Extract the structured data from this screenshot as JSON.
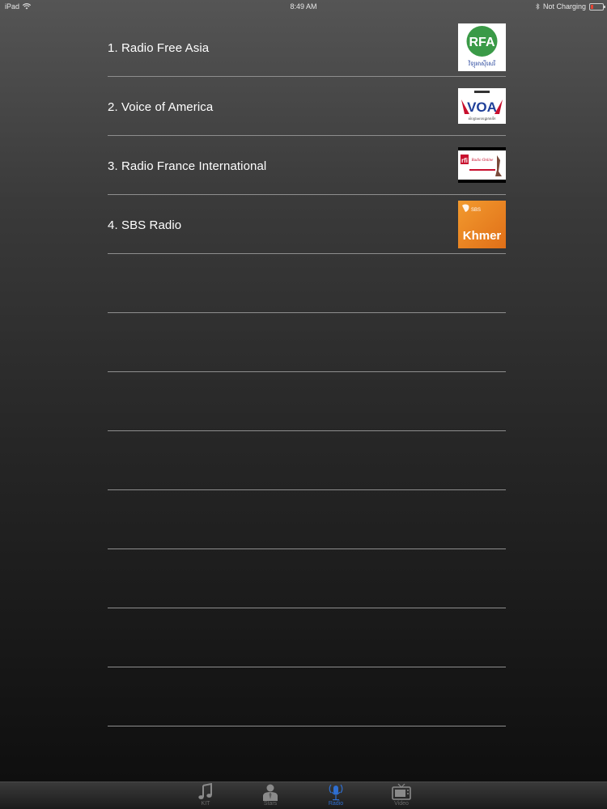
{
  "status_bar": {
    "device": "iPad",
    "time": "8:49 AM",
    "charging": "Not Charging"
  },
  "stations": [
    {
      "label": "1. Radio Free Asia",
      "logo_text": "RFA",
      "logo_subtext": "វិទ្យុអាស៊ីសេរី"
    },
    {
      "label": "2. Voice of America",
      "logo_text": "VOA",
      "logo_subtext": "សំឡេងសហរដ្ឋអាមេរិក"
    },
    {
      "label": "3. Radio France International",
      "logo_text": "rfi",
      "logo_subtext": "Radio Online"
    },
    {
      "label": "4. SBS Radio",
      "logo_text": "Khmer",
      "logo_subtext": "SBS"
    }
  ],
  "tabs": [
    {
      "label": "KIT",
      "icon": "music-note-icon",
      "active": false
    },
    {
      "label": "Stars",
      "icon": "person-icon",
      "active": false
    },
    {
      "label": "Radio",
      "icon": "microphone-icon",
      "active": true
    },
    {
      "label": "Video",
      "icon": "tv-icon",
      "active": false
    }
  ],
  "colors": {
    "active_tab": "#2f6fd1",
    "inactive_tab": "#6a6a6a",
    "rfa_green": "#3a9a47",
    "voa_red": "#c8102e",
    "voa_blue": "#1f3f99",
    "sbs_orange": "#ef8a22"
  }
}
